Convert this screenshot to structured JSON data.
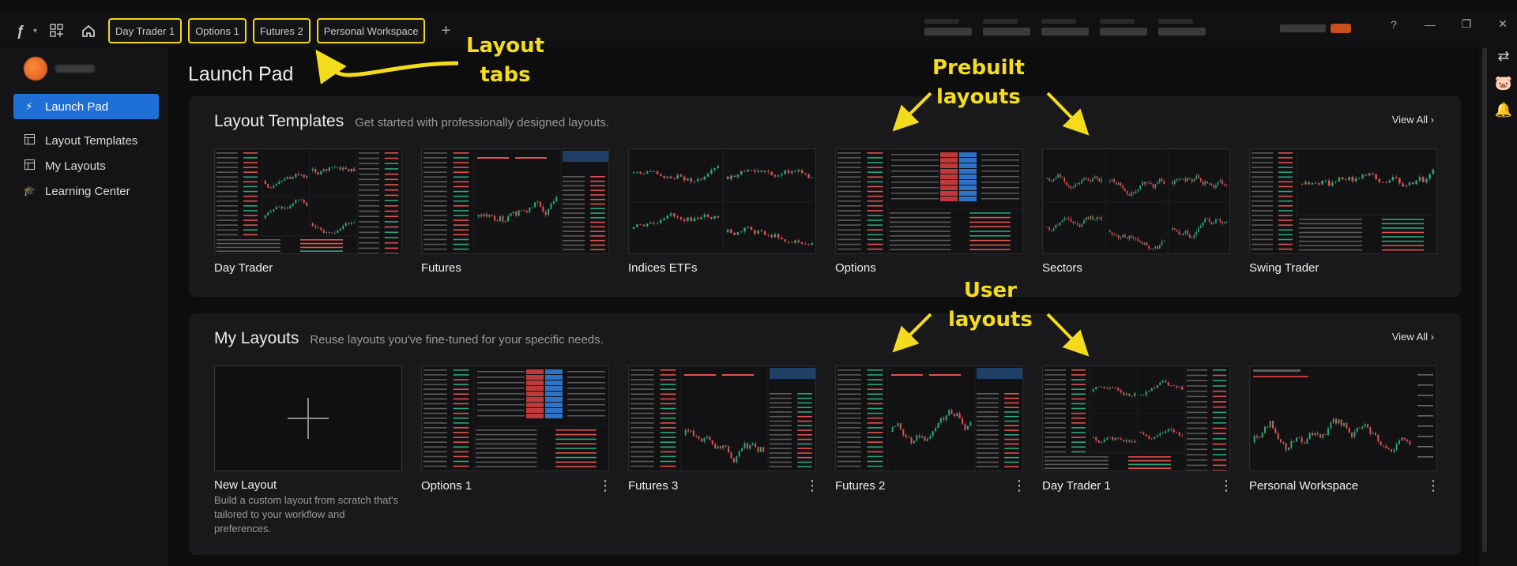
{
  "topbar": {
    "tabs": [
      "Day Trader 1",
      "Options 1",
      "Futures 2",
      "Personal Workspace"
    ],
    "add_tab": "+"
  },
  "sidebar": {
    "items": [
      {
        "label": "Launch Pad",
        "icon": "lightning-icon",
        "active": true
      },
      {
        "label": "Layout Templates",
        "icon": "grid-icon",
        "active": false
      },
      {
        "label": "My Layouts",
        "icon": "grid-icon",
        "active": false
      },
      {
        "label": "Learning Center",
        "icon": "graduation-cap-icon",
        "active": false
      }
    ]
  },
  "main": {
    "title": "Launch Pad",
    "templates": {
      "title": "Layout Templates",
      "subtitle": "Get started with professionally designed layouts.",
      "view_all": "View All",
      "cards": [
        "Day Trader",
        "Futures",
        "Indices ETFs",
        "Options",
        "Sectors",
        "Swing Trader"
      ]
    },
    "my_layouts": {
      "title": "My Layouts",
      "subtitle": "Reuse layouts you've fine-tuned for your specific needs.",
      "view_all": "View All",
      "new_layout": {
        "title": "New Layout",
        "description": "Build a custom layout from scratch that's tailored to your workflow and preferences."
      },
      "cards": [
        "Options 1",
        "Futures 3",
        "Futures 2",
        "Day Trader 1",
        "Personal Workspace"
      ]
    }
  },
  "annotations": {
    "layout_tabs": "Layout\ntabs",
    "prebuilt": "Prebuilt\nlayouts",
    "user": "User\nlayouts"
  },
  "colors": {
    "accent": "#1e6fd6",
    "annotation": "#f4dc1d",
    "candle_up": "#2ea57a",
    "candle_down": "#e0534f"
  }
}
